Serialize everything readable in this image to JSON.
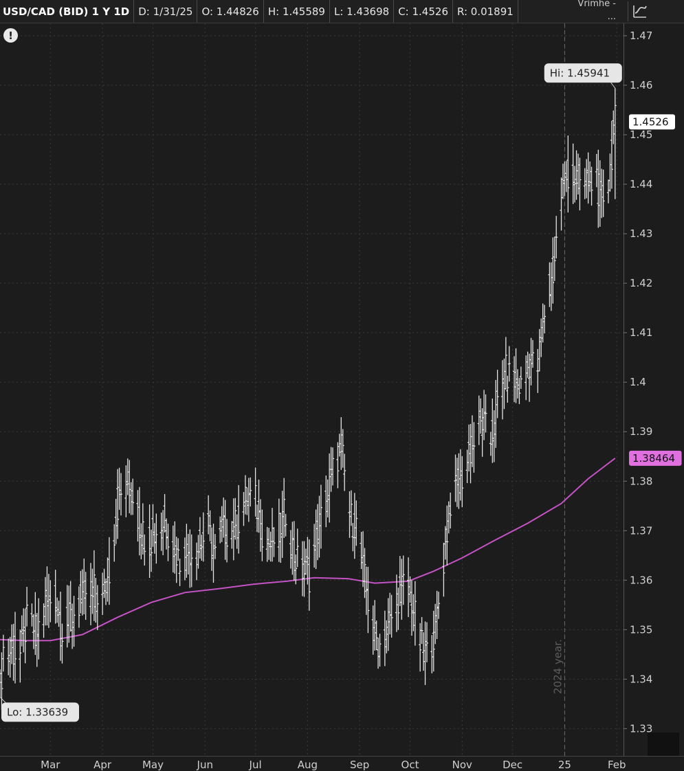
{
  "header": {
    "title": "USD/CAD (BID) 1 Y 1D",
    "date": "D: 1/31/25",
    "open": "O: 1.44826",
    "high": "H: 1.45589",
    "low": "L: 1.43698",
    "close": "C: 1.4526",
    "range": "R: 0.01891",
    "tools_top": "Vrimhe -",
    "tools_bottom": "..."
  },
  "icons": {
    "alert": "!",
    "style": "chart-style-icon"
  },
  "colors": {
    "background": "#1c1c1c",
    "bars": "#e6e6e6",
    "sma": "#c653c6",
    "grid": "#3a3a3a"
  },
  "chart_data": {
    "type": "ohlc",
    "title": "USD/CAD (BID) 1 Y 1D",
    "y_ticks": [
      1.33,
      1.34,
      1.35,
      1.36,
      1.37,
      1.38,
      1.39,
      1.4,
      1.41,
      1.42,
      1.43,
      1.44,
      1.45,
      1.46,
      1.47
    ],
    "y_tick_labels": [
      "1.33",
      "1.34",
      "1.35",
      "1.36",
      "1.37",
      "1.38",
      "1.39",
      "1.4",
      "1.41",
      "1.42",
      "1.43",
      "1.44",
      "1.45",
      "1.46",
      "1.47"
    ],
    "ylim": [
      1.3245,
      1.4725
    ],
    "x_tick_labels": [
      "Mar",
      "Apr",
      "May",
      "Jun",
      "Jul",
      "Aug",
      "Sep",
      "Oct",
      "Nov",
      "Dec",
      "25",
      "Feb"
    ],
    "x_tick_dates": [
      "2024-03-01",
      "2024-04-01",
      "2024-05-01",
      "2024-06-01",
      "2024-07-01",
      "2024-08-01",
      "2024-09-01",
      "2024-10-01",
      "2024-11-01",
      "2024-12-01",
      "2025-01-01",
      "2025-02-01"
    ],
    "xlim": [
      "2024-01-31",
      "2025-02-05"
    ],
    "year_separator": {
      "date": "2025-01-01",
      "label": "2024 year."
    },
    "price_series": {
      "name": "USD/CAD",
      "color": "#e6e6e6",
      "points": [
        [
          "2024-01-31",
          1.3364
        ],
        [
          "2024-02-02",
          1.346
        ],
        [
          "2024-02-07",
          1.3455
        ],
        [
          "2024-02-12",
          1.345
        ],
        [
          "2024-02-16",
          1.3515
        ],
        [
          "2024-02-22",
          1.3495
        ],
        [
          "2024-02-27",
          1.355
        ],
        [
          "2024-03-04",
          1.357
        ],
        [
          "2024-03-08",
          1.35
        ],
        [
          "2024-03-13",
          1.3525
        ],
        [
          "2024-03-18",
          1.355
        ],
        [
          "2024-03-22",
          1.3575
        ],
        [
          "2024-03-27",
          1.358
        ],
        [
          "2024-04-01",
          1.356
        ],
        [
          "2024-04-05",
          1.362
        ],
        [
          "2024-04-10",
          1.375
        ],
        [
          "2024-04-15",
          1.38
        ],
        [
          "2024-04-19",
          1.377
        ],
        [
          "2024-04-24",
          1.37
        ],
        [
          "2024-04-29",
          1.368
        ],
        [
          "2024-05-03",
          1.37
        ],
        [
          "2024-05-08",
          1.372
        ],
        [
          "2024-05-13",
          1.367
        ],
        [
          "2024-05-17",
          1.364
        ],
        [
          "2024-05-22",
          1.366
        ],
        [
          "2024-05-27",
          1.366
        ],
        [
          "2024-06-03",
          1.37
        ],
        [
          "2024-06-07",
          1.365
        ],
        [
          "2024-06-12",
          1.37
        ],
        [
          "2024-06-17",
          1.37
        ],
        [
          "2024-06-21",
          1.372
        ],
        [
          "2024-06-26",
          1.377
        ],
        [
          "2024-07-01",
          1.376
        ],
        [
          "2024-07-05",
          1.37
        ],
        [
          "2024-07-10",
          1.367
        ],
        [
          "2024-07-15",
          1.37
        ],
        [
          "2024-07-19",
          1.374
        ],
        [
          "2024-07-24",
          1.365
        ],
        [
          "2024-07-29",
          1.362
        ],
        [
          "2024-08-02",
          1.361
        ],
        [
          "2024-08-07",
          1.37
        ],
        [
          "2024-08-12",
          1.376
        ],
        [
          "2024-08-16",
          1.382
        ],
        [
          "2024-08-21",
          1.387
        ],
        [
          "2024-08-26",
          1.373
        ],
        [
          "2024-08-30",
          1.371
        ],
        [
          "2024-09-04",
          1.36
        ],
        [
          "2024-09-09",
          1.349
        ],
        [
          "2024-09-13",
          1.347
        ],
        [
          "2024-09-18",
          1.35
        ],
        [
          "2024-09-23",
          1.356
        ],
        [
          "2024-09-27",
          1.359
        ],
        [
          "2024-10-02",
          1.356
        ],
        [
          "2024-10-07",
          1.347
        ],
        [
          "2024-10-11",
          1.345
        ],
        [
          "2024-10-16",
          1.35
        ],
        [
          "2024-10-21",
          1.364
        ],
        [
          "2024-10-25",
          1.376
        ],
        [
          "2024-10-30",
          1.379
        ],
        [
          "2024-11-04",
          1.384
        ],
        [
          "2024-11-08",
          1.388
        ],
        [
          "2024-11-13",
          1.392
        ],
        [
          "2024-11-18",
          1.388
        ],
        [
          "2024-11-22",
          1.395
        ],
        [
          "2024-11-27",
          1.402
        ],
        [
          "2024-12-02",
          1.4
        ],
        [
          "2024-12-06",
          1.399
        ],
        [
          "2024-12-11",
          1.404
        ],
        [
          "2024-12-16",
          1.403
        ],
        [
          "2024-12-20",
          1.414
        ],
        [
          "2024-12-25",
          1.422
        ],
        [
          "2024-12-30",
          1.438
        ],
        [
          "2025-01-03",
          1.442
        ],
        [
          "2025-01-08",
          1.441
        ],
        [
          "2025-01-13",
          1.44
        ],
        [
          "2025-01-17",
          1.442
        ],
        [
          "2025-01-22",
          1.438
        ],
        [
          "2025-01-27",
          1.44
        ],
        [
          "2025-01-31",
          1.4526
        ]
      ],
      "last_value_label": "1.4526",
      "high_label": "Hi: 1.45941",
      "high": [
        "2025-01-31",
        1.45941
      ],
      "low_label": "Lo: 1.33639",
      "low": [
        "2024-01-31",
        1.33639
      ]
    },
    "sma_series": {
      "color": "#c653c6",
      "points": [
        [
          "2024-01-31",
          1.348
        ],
        [
          "2024-02-15",
          1.3478
        ],
        [
          "2024-03-01",
          1.3478
        ],
        [
          "2024-03-20",
          1.349
        ],
        [
          "2024-04-10",
          1.3525
        ],
        [
          "2024-04-30",
          1.3555
        ],
        [
          "2024-05-20",
          1.3575
        ],
        [
          "2024-06-10",
          1.3583
        ],
        [
          "2024-06-30",
          1.3592
        ],
        [
          "2024-07-20",
          1.3598
        ],
        [
          "2024-08-05",
          1.3605
        ],
        [
          "2024-08-25",
          1.3603
        ],
        [
          "2024-09-10",
          1.3594
        ],
        [
          "2024-09-30",
          1.3598
        ],
        [
          "2024-10-15",
          1.3618
        ],
        [
          "2024-11-01",
          1.3645
        ],
        [
          "2024-11-20",
          1.368
        ],
        [
          "2024-12-10",
          1.3715
        ],
        [
          "2024-12-30",
          1.3755
        ],
        [
          "2025-01-15",
          1.3805
        ],
        [
          "2025-01-31",
          1.38464
        ]
      ],
      "last_value_label": "1.38464"
    }
  }
}
